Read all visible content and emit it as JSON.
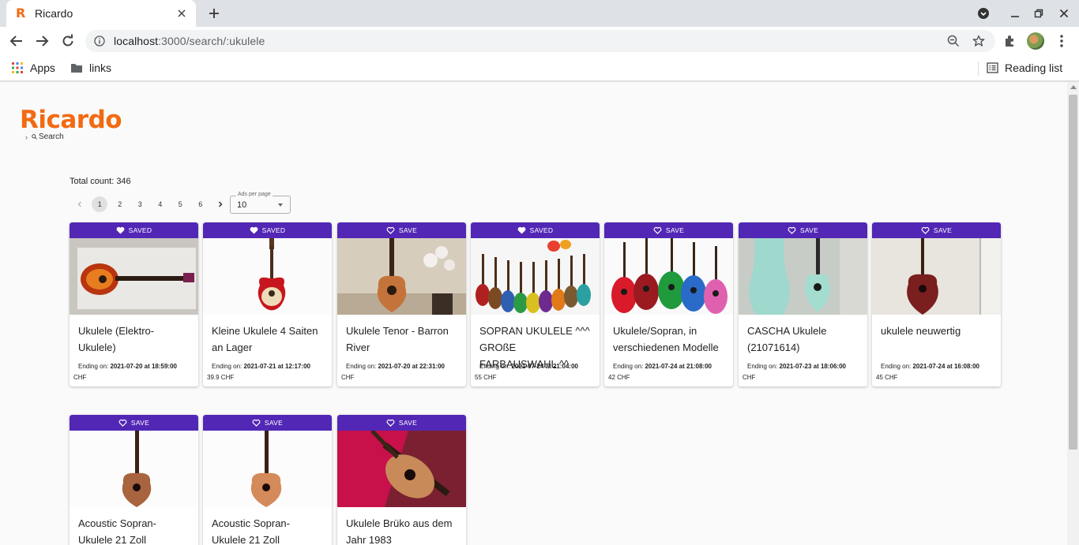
{
  "browser": {
    "tab_title": "Ricardo",
    "url_host": "localhost",
    "url_rest": ":3000/search/:ukulele",
    "bookmarks": {
      "apps": "Apps",
      "links": "links",
      "reading_list": "Reading list"
    }
  },
  "page": {
    "logo": "Ricardo",
    "breadcrumb": "Search",
    "total_count": "Total count: 346",
    "pagination": {
      "pages": [
        "1",
        "2",
        "3",
        "4",
        "5",
        "6"
      ],
      "current": "1"
    },
    "ads_per_page": {
      "label": "Ads per page",
      "value": "10"
    }
  },
  "colors": {
    "brand": "#f26a12",
    "save_bar": "#5227b5"
  },
  "listings": [
    {
      "save_label": "SAVED",
      "saved": true,
      "title": "Ukulele (Elektro-Ukulele)",
      "ending_prefix": "Ending on: ",
      "ending": "2021-07-20 at 18:59:00",
      "price": "CHF"
    },
    {
      "save_label": "SAVED",
      "saved": true,
      "title": "Kleine Ukulele 4 Saiten an Lager",
      "ending_prefix": "Ending on: ",
      "ending": "2021-07-21 at 12:17:00",
      "price": "39.9 CHF"
    },
    {
      "save_label": "SAVE",
      "saved": false,
      "title": "Ukulele Tenor - Barron River",
      "ending_prefix": "Ending on: ",
      "ending": "2021-07-20 at 22:31:00",
      "price": "CHF"
    },
    {
      "save_label": "SAVED",
      "saved": true,
      "title": "SOPRAN UKULELE ^^^ GROßE FARBAUSWAHL ^^",
      "ending_prefix": "Ending on: ",
      "ending": "2021-07-24 at 21:04:00",
      "price": "55 CHF"
    },
    {
      "save_label": "SAVE",
      "saved": false,
      "title": "Ukulele/Sopran, in verschiedenen Modelle",
      "ending_prefix": "Ending on: ",
      "ending": "2021-07-24 at 21:08:00",
      "price": "42 CHF"
    },
    {
      "save_label": "SAVE",
      "saved": false,
      "title": "CASCHA Ukulele (21071614)",
      "ending_prefix": "Ending on: ",
      "ending": "2021-07-23 at 18:06:00",
      "price": "CHF"
    },
    {
      "save_label": "SAVE",
      "saved": false,
      "title": "ukulele neuwertig",
      "ending_prefix": "Ending on: ",
      "ending": "2021-07-24 at 16:08:00",
      "price": "45 CHF"
    },
    {
      "save_label": "SAVE",
      "saved": false,
      "title": "Acoustic Sopran-Ukulele 21 Zoll",
      "ending_prefix": "",
      "ending": "",
      "price": ""
    },
    {
      "save_label": "SAVE",
      "saved": false,
      "title": "Acoustic Sopran-Ukulele 21 Zoll",
      "ending_prefix": "",
      "ending": "",
      "price": ""
    },
    {
      "save_label": "SAVE",
      "saved": false,
      "title": "Ukulele Brüko aus dem Jahr 1983",
      "ending_prefix": "",
      "ending": "",
      "price": ""
    }
  ]
}
